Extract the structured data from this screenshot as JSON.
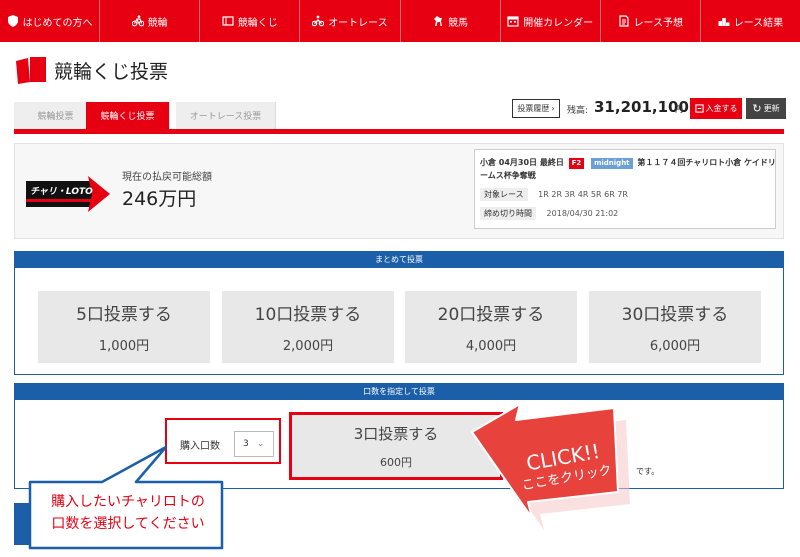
{
  "nav": [
    {
      "label": "はじめての方へ",
      "icon": "shield-icon"
    },
    {
      "label": "競輪",
      "icon": "bicycle-icon"
    },
    {
      "label": "競輪くじ",
      "icon": "ticket-icon"
    },
    {
      "label": "オートレース",
      "icon": "motorbike-icon"
    },
    {
      "label": "競馬",
      "icon": "horse-icon"
    },
    {
      "label": "開催カレンダー",
      "icon": "calendar-icon"
    },
    {
      "label": "レース予想",
      "icon": "document-icon"
    },
    {
      "label": "レース結果",
      "icon": "podium-icon"
    }
  ],
  "page": {
    "title": "競輪くじ投票"
  },
  "tabs": [
    "競輪投票",
    "競輪くじ投票",
    "オートレース投票"
  ],
  "account": {
    "result_label": "投票履歴",
    "balance_label": "残高:",
    "balance_value": "31,201,100",
    "balance_unit": "円",
    "deposit_label": "入金する",
    "refresh_label": "更新"
  },
  "info": {
    "payout_label": "現在の払戻可能総額",
    "payout_value": "246万円",
    "race_prefix": "小倉 04月30日 最終日",
    "race_badge1": "F2",
    "race_badge2": "midnight",
    "race_name": "第１１７４回チャリロト小倉 ケイドリームス杯争奪戦",
    "target_label": "対象レース",
    "target_value": "1R 2R 3R 4R 5R 6R 7R",
    "deadline_label": "締め切り時間",
    "deadline_value": "2018/04/30 21:02"
  },
  "bulk": {
    "header": "まとめて投票",
    "buttons": [
      {
        "label": "5口投票する",
        "price": "1,000円"
      },
      {
        "label": "10口投票する",
        "price": "2,000円"
      },
      {
        "label": "20口投票する",
        "price": "4,000円"
      },
      {
        "label": "30口投票する",
        "price": "6,000円"
      }
    ]
  },
  "specific": {
    "header": "口数を指定して投票",
    "qty_label": "購入口数",
    "qty_value": "3",
    "vote_label": "3口投票する",
    "vote_price": "600円",
    "trailing_text": "です。"
  },
  "annotations": {
    "callout_line1": "購入したいチャリロトの",
    "callout_line2": "口数を選択してください",
    "click_line1": "CLICK!!",
    "click_line2": "ここをクリック"
  },
  "colors": {
    "brand_red": "#e60012",
    "panel_blue": "#1a5fa8"
  }
}
